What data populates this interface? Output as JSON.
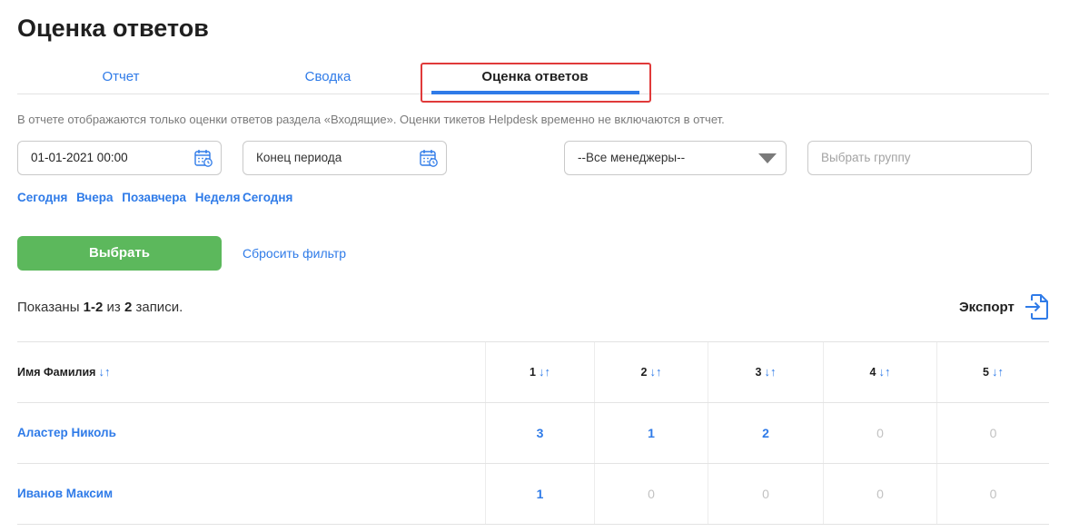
{
  "page": {
    "title": "Оценка ответов"
  },
  "tabs": [
    {
      "label": "Отчет"
    },
    {
      "label": "Сводка"
    },
    {
      "label": "Оценка ответов"
    }
  ],
  "info_text": "В отчете отображаются только оценки ответов раздела «Входящие». Оценки тикетов Helpdesk временно не включаются в отчет.",
  "filters": {
    "start_date": {
      "value": "01-01-2021 00:00"
    },
    "end_date": {
      "placeholder": "Конец периода"
    },
    "managers": {
      "selected": "--Все менеджеры--"
    },
    "group": {
      "placeholder": "Выбрать группу"
    },
    "start_quick": [
      "Сегодня",
      "Вчера",
      "Позавчера",
      "Неделя"
    ],
    "end_quick": [
      "Сегодня"
    ],
    "select_button": "Выбрать",
    "reset_link": "Сбросить фильтр"
  },
  "summary": {
    "prefix": "Показаны",
    "range": "1-2",
    "middle": "из",
    "total": "2",
    "suffix": "записи."
  },
  "export": {
    "label": "Экспорт"
  },
  "table": {
    "columns": [
      "Имя Фамилия",
      "1",
      "2",
      "3",
      "4",
      "5"
    ],
    "rows": [
      {
        "name": "Аластер Николь",
        "values": [
          "3",
          "1",
          "2",
          "0",
          "0"
        ]
      },
      {
        "name": "Иванов Максим",
        "values": [
          "1",
          "0",
          "0",
          "0",
          "0"
        ]
      }
    ]
  },
  "icons": {
    "calendar": "calendar-icon",
    "sort": "sort-arrows-icon",
    "export": "export-icon",
    "dropdown": "chevron-down-icon"
  },
  "colors": {
    "accent": "#2f7be8",
    "primary_button": "#5cb85c",
    "highlight_border": "#e03a3a",
    "muted_value": "#c2c2c2"
  }
}
